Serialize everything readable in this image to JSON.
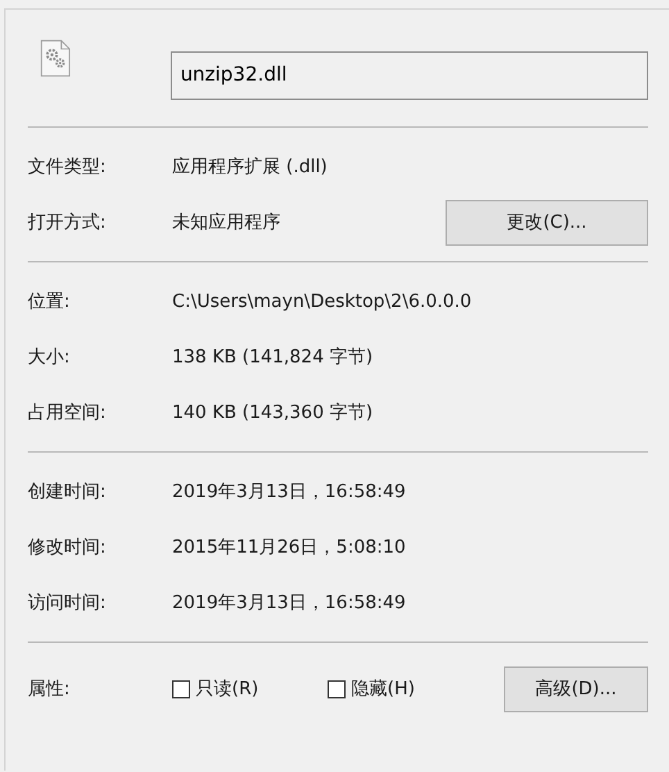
{
  "file_name": {
    "value": "unzip32.dll"
  },
  "sections": [
    {
      "rows": [
        {
          "label": "文件类型:",
          "value": "应用程序扩展 (.dll)"
        },
        {
          "label": "打开方式:",
          "value": "未知应用程序",
          "button": "更改(C)..."
        }
      ]
    },
    {
      "rows": [
        {
          "label": "位置:",
          "value": "C:\\Users\\mayn\\Desktop\\2\\6.0.0.0"
        },
        {
          "label": "大小:",
          "value": "138 KB (141,824 字节)"
        },
        {
          "label": "占用空间:",
          "value": "140 KB (143,360 字节)"
        }
      ]
    },
    {
      "rows": [
        {
          "label": "创建时间:",
          "value": "2019年3月13日，16:58:49"
        },
        {
          "label": "修改时间:",
          "value": "2015年11月26日，5:08:10"
        },
        {
          "label": "访问时间:",
          "value": "2019年3月13日，16:58:49"
        }
      ]
    }
  ],
  "attributes": {
    "label": "属性:",
    "checkboxes": [
      {
        "label": "只读(R)",
        "checked": false
      },
      {
        "label": "隐藏(H)",
        "checked": false
      }
    ],
    "button": "高级(D)..."
  }
}
